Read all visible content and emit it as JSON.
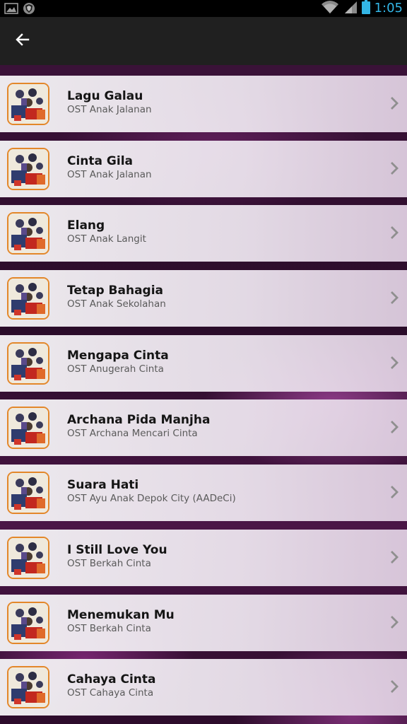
{
  "status_bar": {
    "time": "1:05",
    "icons": [
      "gallery-icon",
      "shield-icon",
      "wifi-icon",
      "signal-icon",
      "battery-icon"
    ]
  },
  "action_bar": {
    "back_icon": "arrow-left-icon"
  },
  "colors": {
    "accent": "#33b5e5",
    "action_bar": "#202020",
    "thumb_border": "#e3872a"
  },
  "songs": [
    {
      "title": "Lagu Galau",
      "subtitle": "OST Anak Jalanan"
    },
    {
      "title": "Cinta Gila",
      "subtitle": "OST Anak Jalanan"
    },
    {
      "title": "Elang",
      "subtitle": "OST Anak Langit"
    },
    {
      "title": "Tetap Bahagia",
      "subtitle": "OST Anak Sekolahan"
    },
    {
      "title": "Mengapa Cinta",
      "subtitle": "OST Anugerah Cinta"
    },
    {
      "title": "Archana Pida Manjha",
      "subtitle": "OST Archana Mencari Cinta"
    },
    {
      "title": "Suara Hati",
      "subtitle": "OST Ayu Anak Depok City (AADeCi)"
    },
    {
      "title": "I Still Love You",
      "subtitle": "OST Berkah Cinta"
    },
    {
      "title": "Menemukan Mu",
      "subtitle": "OST Berkah Cinta"
    },
    {
      "title": "Cahaya Cinta",
      "subtitle": "OST Cahaya Cinta"
    }
  ]
}
